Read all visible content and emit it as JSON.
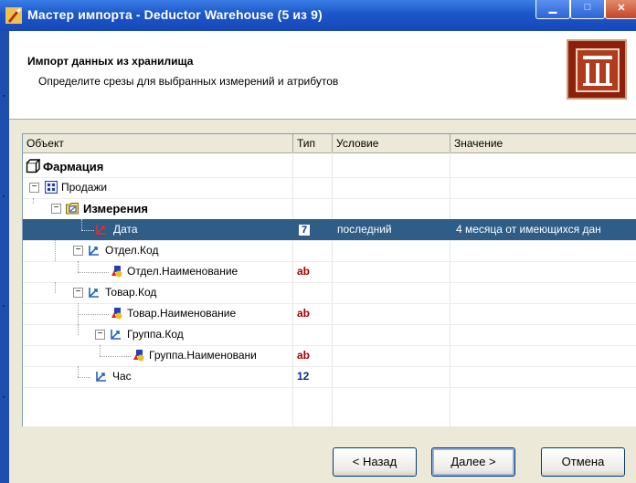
{
  "window": {
    "title": "Мастер импорта - Deductor Warehouse (5 из 9)",
    "accent": "#2e5d87"
  },
  "header": {
    "title": "Импорт данных из хранилища",
    "subtitle": "Определите срезы для выбранных измерений и атрибутов"
  },
  "columns": [
    "Объект",
    "Тип",
    "Условие",
    "Значение"
  ],
  "rows": [
    {
      "label": "Фармация",
      "type": "",
      "condition": "",
      "value": ""
    },
    {
      "label": "Продажи",
      "type": "",
      "condition": "",
      "value": ""
    },
    {
      "label": "Измерения",
      "type": "",
      "condition": "",
      "value": ""
    },
    {
      "label": "Дата",
      "type": "7",
      "condition": "последний",
      "value": "4 месяца от имеющихся дан"
    },
    {
      "label": "Отдел.Код",
      "type": "",
      "condition": "",
      "value": ""
    },
    {
      "label": "Отдел.Наименование",
      "type": "ab",
      "condition": "",
      "value": ""
    },
    {
      "label": "Товар.Код",
      "type": "",
      "condition": "",
      "value": ""
    },
    {
      "label": "Товар.Наименование",
      "type": "ab",
      "condition": "",
      "value": ""
    },
    {
      "label": "Группа.Код",
      "type": "",
      "condition": "",
      "value": ""
    },
    {
      "label": "Группа.Наименовани",
      "type": "ab",
      "condition": "",
      "value": ""
    },
    {
      "label": "Час",
      "type": "12",
      "condition": "",
      "value": ""
    }
  ],
  "buttons": {
    "back": "< Назад",
    "next": "Далее >",
    "cancel": "Отмена"
  }
}
